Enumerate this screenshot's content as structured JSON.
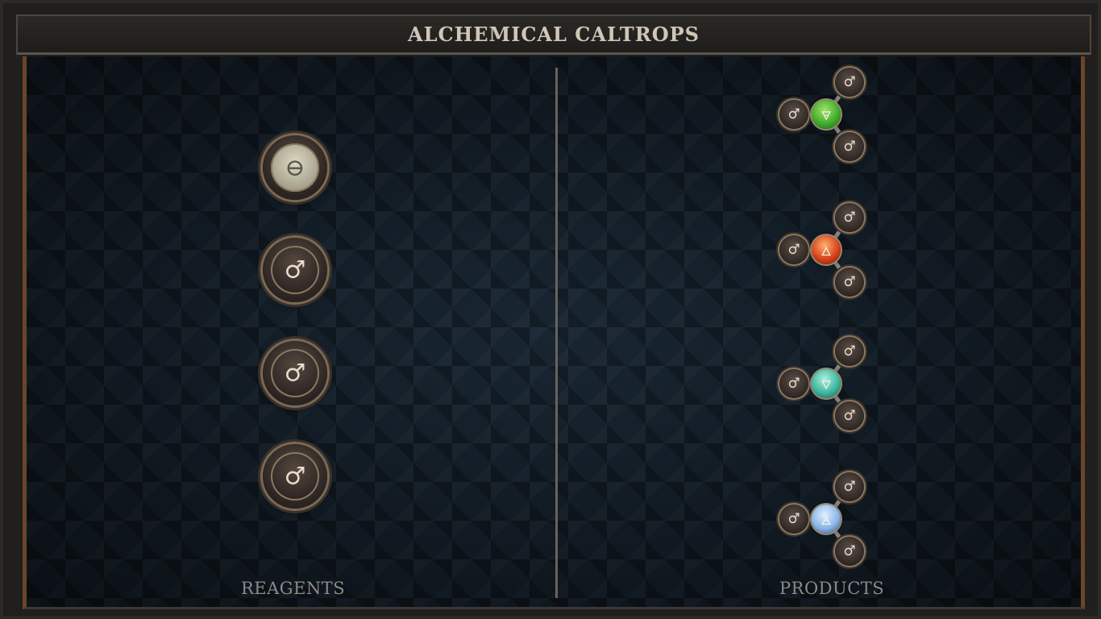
{
  "title": "ALCHEMICAL CALTROPS",
  "labels": {
    "reagents": "REAGENTS",
    "products": "PRODUCTS"
  },
  "reagents": [
    {
      "name": "salt",
      "symbol": "⊖"
    },
    {
      "name": "iron",
      "symbol": "♂"
    },
    {
      "name": "iron",
      "symbol": "♂"
    },
    {
      "name": "iron",
      "symbol": "♂"
    }
  ],
  "products": [
    {
      "core_symbol": "🜃",
      "core_color": "#3fae2c",
      "node_symbol": "♂"
    },
    {
      "core_symbol": "🜂",
      "core_color": "#d8431a",
      "node_symbol": "♂"
    },
    {
      "core_symbol": "🜄",
      "core_color": "#3fb6a0",
      "node_symbol": "♂"
    },
    {
      "core_symbol": "🜁",
      "core_color": "#8ab6e8",
      "node_symbol": "♂"
    }
  ]
}
